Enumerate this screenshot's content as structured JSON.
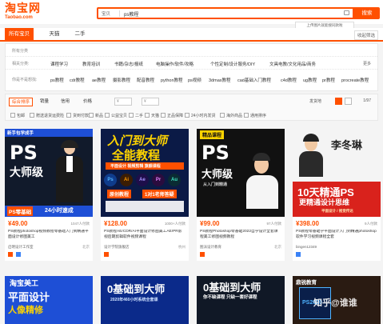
{
  "logo": {
    "cn": "淘宝网",
    "en": "Taobao.com"
  },
  "search": {
    "scope": "宝贝",
    "value": "ps教程",
    "button": "搜索",
    "photo_tip": "上传图片就能搜同款啦"
  },
  "tabs": [
    {
      "label": "所有宝贝"
    },
    {
      "label": "天猫"
    },
    {
      "label": "二手"
    }
  ],
  "tabs_right": "收起筛选",
  "filters": {
    "row1_label": "所有分类",
    "row2_label": "相关分类:",
    "row2_items": [
      "课程学习",
      "教育培训",
      "书籍/杂志/报纸",
      "电脑操作/软件/攻略",
      "个性定制/设计服务/DIY",
      "文具电教/文化用品/商务"
    ],
    "row3_label": "你是不是想找:",
    "row3_items": [
      "ps教程",
      "cdr教程",
      "ae教程",
      "摄影教程",
      "配音教程",
      "python教程",
      "ps视频",
      "3dmax教程",
      "cad基础入门教程",
      "c4d教程",
      "ug教程",
      "pr教程",
      "procreate教程"
    ],
    "more": "更多"
  },
  "sort": {
    "items": [
      "综合排序",
      "销量",
      "信用",
      "价格"
    ],
    "price_from": "¥",
    "price_to": "¥",
    "checkboxes": [
      "包邮",
      "赠送退货运费险",
      "货到付款",
      "新品",
      "公益宝贝",
      "二手",
      "天猫",
      "正品保障",
      "24小时内发货",
      "海外商品",
      "通用排序"
    ],
    "ship_to": "发货地",
    "pager": "1/97"
  },
  "products": [
    {
      "price": "¥49.00",
      "sales": "1047人付款",
      "title": "PS教程photoshop视频教程零基础入门到精通平面设计修图美工",
      "shop": "启明设计工作室",
      "loc": "北京",
      "banner_top": "新手包学成手",
      "big1": "PS",
      "big2": "大师级",
      "tag1": "PS零基础",
      "tag2": "24小时速成"
    },
    {
      "price": "¥128.00",
      "sales": "1000+人付款",
      "title": "PS教程AE/CDR/AI平面设计修图美工AE/PR影视后期剪辑软件视频课程",
      "shop": "设计学院旗舰店",
      "loc": "杭州",
      "big1": "入门到大师",
      "big2": "全能教程",
      "sub": "平面设计 视频剪辑 旗舰课程",
      "apps": [
        "Ps",
        "Ai",
        "Ae",
        "Pr",
        "Au"
      ],
      "tag1": "原创教程",
      "tag2": "1对1老师答疑"
    },
    {
      "price": "¥99.00",
      "sales": "97人付款",
      "title": "PS教程Photoshop零基础2022自学设计全套课程美工修图视频教程",
      "shop": "图派设计教育",
      "loc": "北京",
      "banner_top": "精品课程",
      "big1": "PS",
      "big2": "大师级",
      "tag1": "从入门到精通"
    },
    {
      "price": "¥398.00",
      "sales": "9人付款",
      "title": "PS教程零基础学平面设计入门到精通photoshop软件学习视频课程全套",
      "shop": "bingen12349",
      "loc": "",
      "teacher": "李冬琳",
      "big1": "10天精通PS",
      "big2": "更精通设计思维",
      "tag1": "平面设计 / 视觉传达"
    }
  ],
  "row2": [
    {
      "top": "淘宝美工",
      "big": "平面设计",
      "sub": "人像精修"
    },
    {
      "big": "0基础到大师",
      "sub": "2020年460小时系统全套课"
    },
    {
      "big": "0基础到大师",
      "sub": "你不缺课程 只缺一套好课程"
    },
    {
      "top": "鼎锐教育",
      "big": "PS2020"
    }
  ],
  "watermark": "知乎@谁谁",
  "colors": {
    "accent": "#ff5000",
    "dark_bg": "#101826",
    "blue": "#1e4fd6"
  }
}
